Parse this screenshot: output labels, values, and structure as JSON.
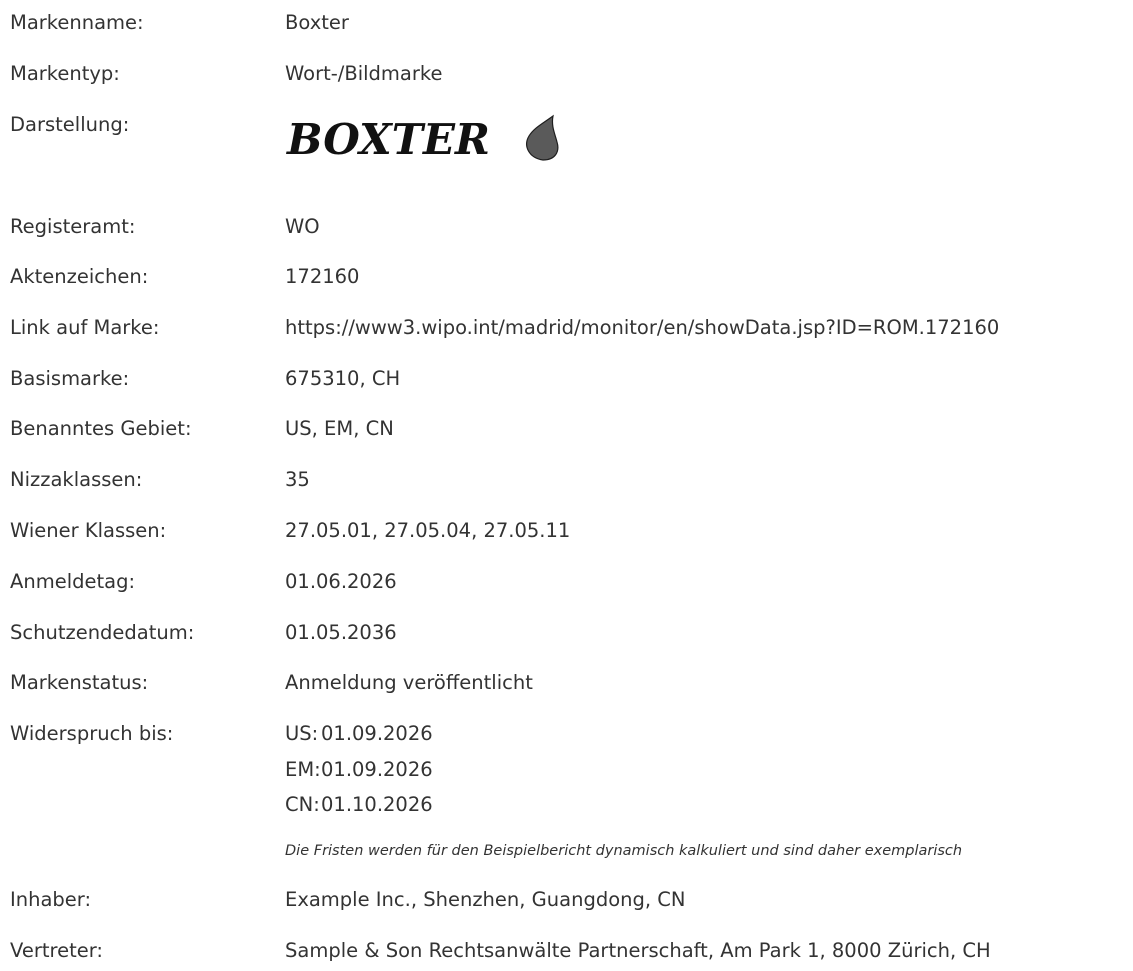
{
  "fields": [
    {
      "label": "Markenname:",
      "value": "Boxter"
    },
    {
      "label": "Markentyp:",
      "value": "Wort-/Bildmarke"
    },
    {
      "label": "Darstellung:",
      "value": ""
    },
    {
      "label": "Registeramt:",
      "value": "WO"
    },
    {
      "label": "Aktenzeichen:",
      "value": "172160"
    },
    {
      "label": "Link auf Marke:",
      "value": "https://www3.wipo.int/madrid/monitor/en/showData.jsp?ID=ROM.172160"
    },
    {
      "label": "Basismarke:",
      "value": "675310, CH"
    },
    {
      "label": "Benanntes Gebiet:",
      "value": "US, EM, CN"
    },
    {
      "label": "Nizzaklassen:",
      "value": "35"
    },
    {
      "label": "Wiener Klassen:",
      "value": "27.05.01, 27.05.04, 27.05.11"
    },
    {
      "label": "Anmeldetag:",
      "value": "01.06.2026"
    },
    {
      "label": "Schutzendedatum:",
      "value": "01.05.2036"
    },
    {
      "label": "Markenstatus:",
      "value": "Anmeldung veröffentlicht"
    },
    {
      "label": "Widerspruch bis:",
      "value": ""
    },
    {
      "label": "Inhaber:",
      "value": "Example Inc., Shenzhen, Guangdong, CN"
    },
    {
      "label": "Vertreter:",
      "value": "Sample & Son Rechtsanwälte Partnerschaft, Am Park 1, 8000 Zürich, CH"
    }
  ],
  "logo": {
    "text": "BOXTER",
    "flame_color": "#5a5a5a"
  },
  "opposition": [
    {
      "code": "US:",
      "date": "01.09.2026"
    },
    {
      "code": "EM:",
      "date": "01.09.2026"
    },
    {
      "code": "CN:",
      "date": "01.10.2026"
    }
  ],
  "note": "Die Fristen werden für den Beispielbericht dynamisch kalkuliert und sind daher exemplarisch"
}
